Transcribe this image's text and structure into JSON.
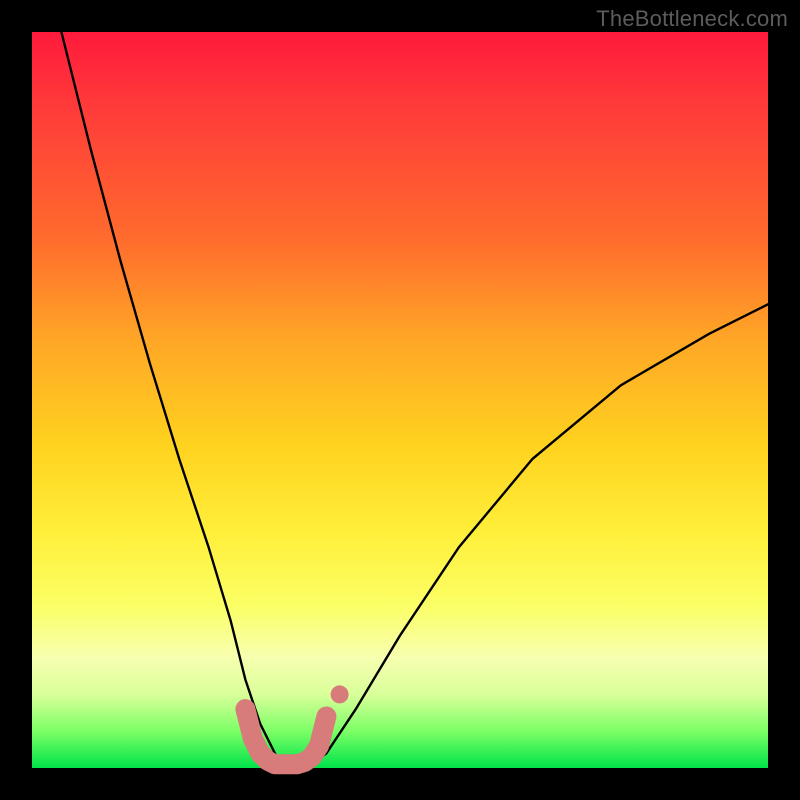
{
  "watermark": "TheBottleneck.com",
  "chart_data": {
    "type": "line",
    "title": "",
    "xlabel": "",
    "ylabel": "",
    "xlim": [
      0,
      100
    ],
    "ylim": [
      0,
      100
    ],
    "series": [
      {
        "name": "bottleneck-curve",
        "x": [
          4,
          8,
          12,
          16,
          20,
          24,
          27,
          29,
          31,
          33,
          34,
          36,
          38,
          40,
          44,
          50,
          58,
          68,
          80,
          92,
          100
        ],
        "values": [
          100,
          84,
          69,
          55,
          42,
          30,
          20,
          12,
          6,
          2,
          0.5,
          0.5,
          0.5,
          2,
          8,
          18,
          30,
          42,
          52,
          59,
          63
        ]
      }
    ],
    "highlight": {
      "name": "floor-segment",
      "color": "#d77b7b",
      "x": [
        29,
        30,
        31,
        32,
        33,
        34,
        35,
        36,
        37,
        38,
        39,
        40
      ],
      "values": [
        8,
        4,
        2,
        1,
        0.5,
        0.5,
        0.5,
        0.5,
        0.8,
        1.5,
        3,
        7
      ]
    }
  },
  "colors": {
    "curve": "#000000",
    "highlight": "#d77b7b",
    "background_top": "#ff1a3c",
    "background_bottom": "#00e34a",
    "frame": "#000000"
  }
}
